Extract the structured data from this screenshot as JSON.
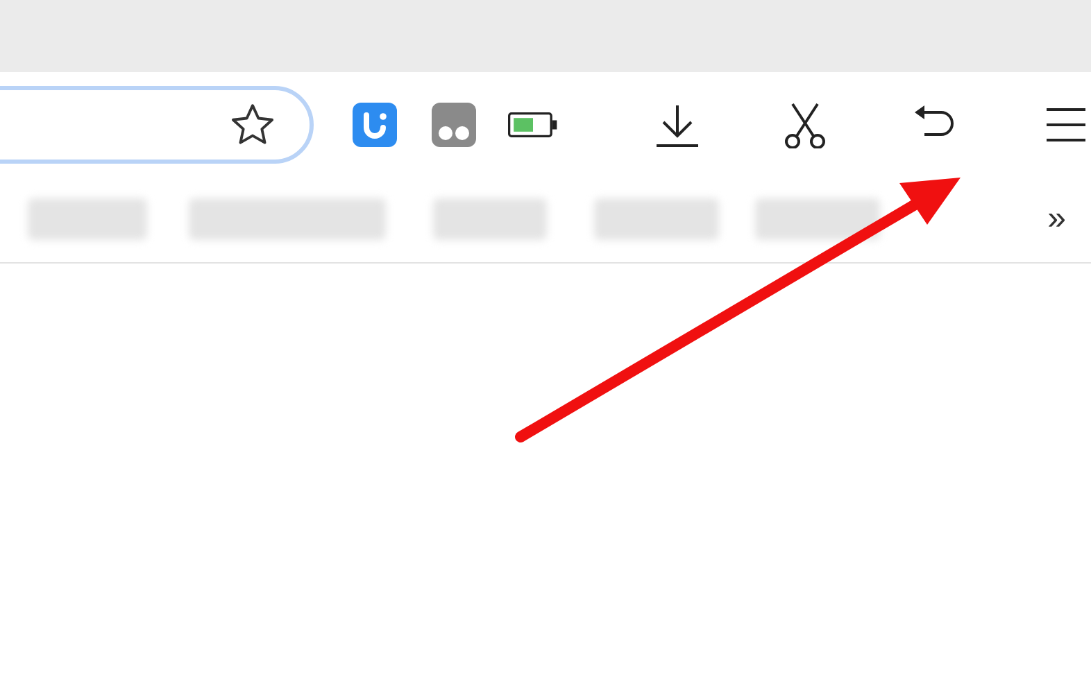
{
  "bookmarks_bar": {
    "overflow_button": "»"
  }
}
